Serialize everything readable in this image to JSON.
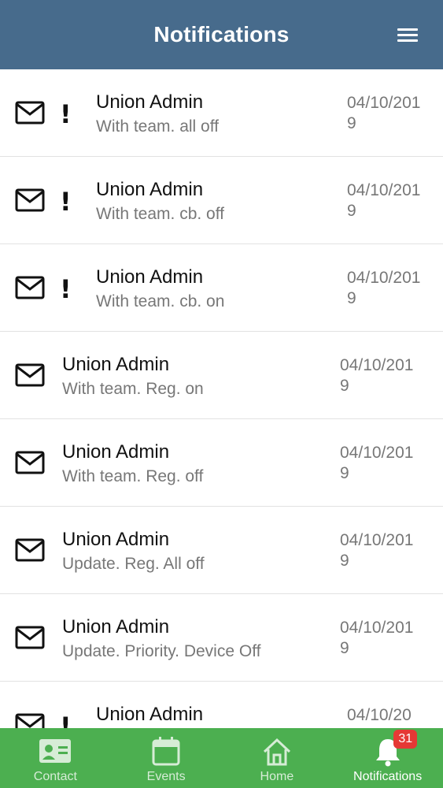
{
  "header": {
    "title": "Notifications"
  },
  "notifications": [
    {
      "sender": "Union Admin",
      "message": "With team. all off",
      "date": "04/10/2019",
      "priority": true
    },
    {
      "sender": "Union Admin",
      "message": "With team. cb. off",
      "date": "04/10/2019",
      "priority": true
    },
    {
      "sender": "Union Admin",
      "message": "With team. cb. on",
      "date": "04/10/2019",
      "priority": true
    },
    {
      "sender": "Union Admin",
      "message": "With team. Reg. on",
      "date": "04/10/2019",
      "priority": false
    },
    {
      "sender": "Union Admin",
      "message": "With team. Reg. off",
      "date": "04/10/2019",
      "priority": false
    },
    {
      "sender": "Union Admin",
      "message": "Update. Reg. All off",
      "date": "04/10/2019",
      "priority": false
    },
    {
      "sender": "Union Admin",
      "message": "Update. Priority. Device Off",
      "date": "04/10/2019",
      "priority": false
    },
    {
      "sender": "Union Admin",
      "message": "",
      "date": "04/10/20",
      "priority": true
    }
  ],
  "priority_mark": "!",
  "tabs": [
    {
      "label": "Contact",
      "icon": "contact-card-icon",
      "active": false
    },
    {
      "label": "Events",
      "icon": "calendar-icon",
      "active": false
    },
    {
      "label": "Home",
      "icon": "home-icon",
      "active": false
    },
    {
      "label": "Notifications",
      "icon": "bell-icon",
      "active": true,
      "badge": "31"
    }
  ],
  "colors": {
    "header": "#476b8c",
    "tabbar": "#4caf50",
    "badge": "#e53935"
  }
}
